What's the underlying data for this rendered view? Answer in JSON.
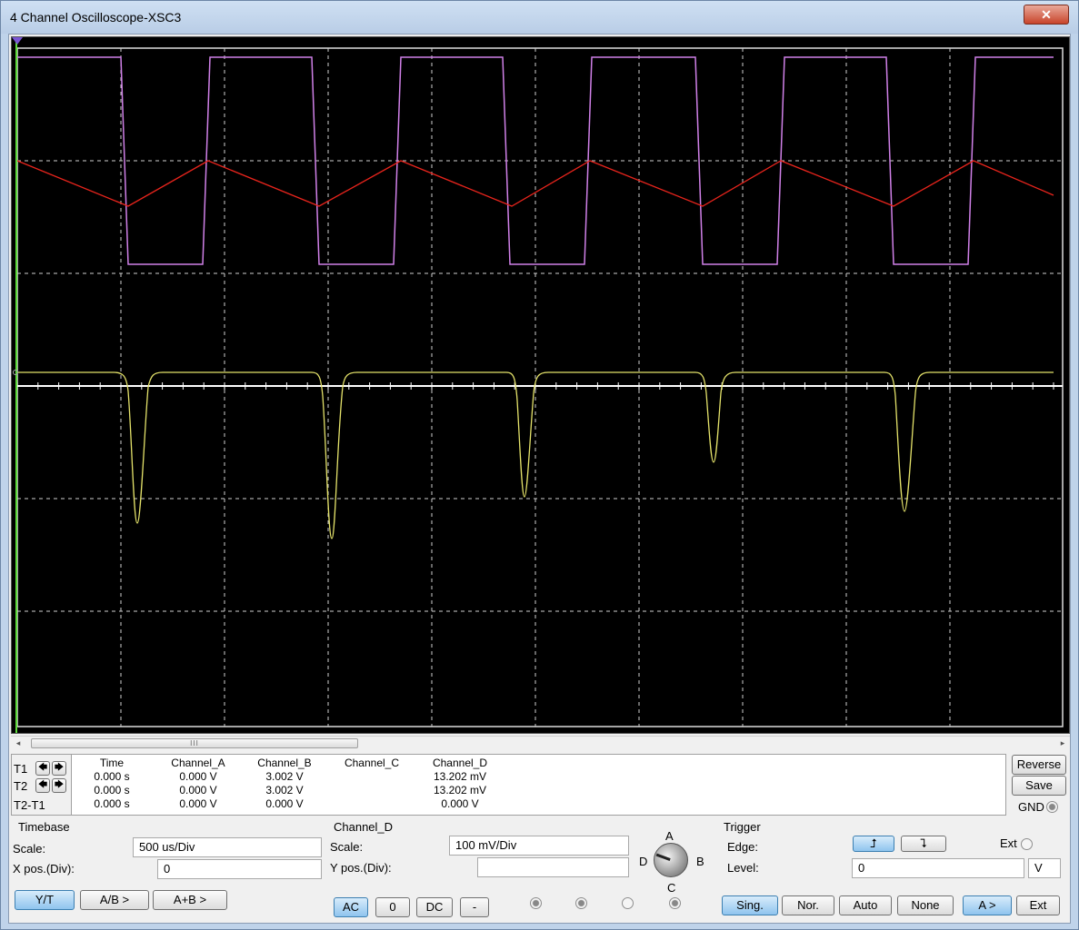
{
  "window": {
    "title": "4 Channel Oscilloscope-XSC3",
    "close_label": "✕"
  },
  "scrollbar": {
    "left_arrow": "◂",
    "right_arrow": "▸",
    "thumb_grip": "III"
  },
  "cursors": {
    "t1_label": "T1",
    "t2_label": "T2",
    "delta_label": "T2-T1",
    "left_arrow": "🡄",
    "right_arrow": "🡆"
  },
  "readout": {
    "headers": [
      "Time",
      "Channel_A",
      "Channel_B",
      "Channel_C",
      "Channel_D"
    ],
    "rows": [
      [
        "0.000 s",
        "0.000 V",
        "3.002 V",
        "",
        "13.202 mV"
      ],
      [
        "0.000 s",
        "0.000 V",
        "3.002 V",
        "",
        "13.202 mV"
      ],
      [
        "0.000 s",
        "0.000 V",
        "0.000 V",
        "",
        "0.000 V"
      ]
    ]
  },
  "side": {
    "reverse": "Reverse",
    "save": "Save",
    "gnd": "GND"
  },
  "timebase": {
    "title": "Timebase",
    "scale_label": "Scale:",
    "scale_value": "500 us/Div",
    "xpos_label": "X pos.(Div):",
    "xpos_value": "0",
    "buttons": [
      "Y/T",
      "A/B >",
      "A+B >"
    ]
  },
  "channel": {
    "title": "Channel_D",
    "scale_label": "Scale:",
    "scale_value": "100 mV/Div",
    "ypos_label": "Y pos.(Div):",
    "ypos_value": "",
    "coupling": [
      "AC",
      "0",
      "DC",
      "-"
    ],
    "knob_labels": {
      "a": "A",
      "b": "B",
      "c": "C",
      "d": "D"
    }
  },
  "trigger": {
    "title": "Trigger",
    "edge_label": "Edge:",
    "ext_label": "Ext",
    "level_label": "Level:",
    "level_value": "0",
    "level_unit": "V",
    "rising_icon": "⮥",
    "falling_icon": "⮧",
    "modes": [
      "Sing.",
      "Nor.",
      "Auto",
      "None"
    ],
    "sources": [
      "A >",
      "Ext"
    ]
  },
  "colors": {
    "screen": "#000000",
    "grid": "#dcdcdc",
    "channel_a": "#d080e8",
    "channel_b": "#e8241c",
    "channel_d": "#e4e26a",
    "cursor": "#5fdc3c",
    "accent_button": "#8fc4ee"
  }
}
